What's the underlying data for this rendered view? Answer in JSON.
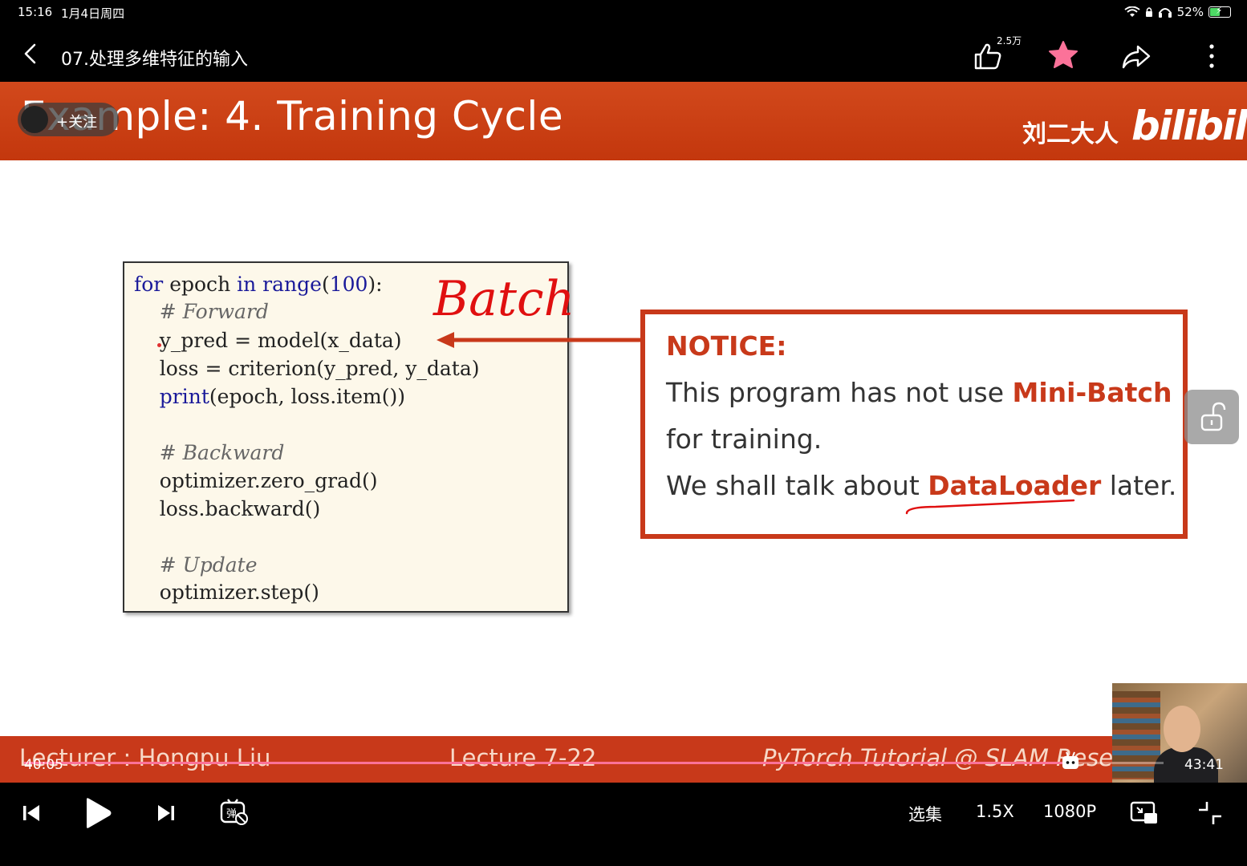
{
  "status_bar": {
    "time": "15:16",
    "date": "1月4日周四",
    "battery_percent": "52%",
    "battery_level": 0.52
  },
  "top_bar": {
    "title": "07.处理多维特征的输入",
    "like_count": "2.5万"
  },
  "slide": {
    "title": "Example: 4. Training Cycle",
    "follow_label": "+关注",
    "uploader": "刘二大人",
    "logo_text": "bilibili",
    "code": [
      {
        "parts": [
          {
            "t": "for",
            "c": "kw"
          },
          {
            "t": " epoch ",
            "c": ""
          },
          {
            "t": "in",
            "c": "kw"
          },
          {
            "t": " range",
            "c": "kw"
          },
          {
            "t": "(",
            "c": ""
          },
          {
            "t": "100",
            "c": "num"
          },
          {
            "t": "):",
            "c": ""
          }
        ]
      },
      {
        "parts": [
          {
            "t": "    # Forward",
            "c": "cmt"
          }
        ]
      },
      {
        "parts": [
          {
            "t": "    y_pred = model(x_data)",
            "c": ""
          }
        ]
      },
      {
        "parts": [
          {
            "t": "    loss = criterion(y_pred, y_data)",
            "c": ""
          }
        ]
      },
      {
        "parts": [
          {
            "t": "    ",
            "c": ""
          },
          {
            "t": "print",
            "c": "kw"
          },
          {
            "t": "(epoch, loss.item())",
            "c": ""
          }
        ]
      },
      {
        "parts": [
          {
            "t": "",
            "c": ""
          }
        ]
      },
      {
        "parts": [
          {
            "t": "    # Backward",
            "c": "cmt"
          }
        ]
      },
      {
        "parts": [
          {
            "t": "    optimizer.zero_grad()",
            "c": ""
          }
        ]
      },
      {
        "parts": [
          {
            "t": "    loss.backward()",
            "c": ""
          }
        ]
      },
      {
        "parts": [
          {
            "t": "",
            "c": ""
          }
        ]
      },
      {
        "parts": [
          {
            "t": "    # Update",
            "c": "cmt"
          }
        ]
      },
      {
        "parts": [
          {
            "t": "    optimizer.step()",
            "c": ""
          }
        ]
      }
    ],
    "handwritten_note": "Batch",
    "notice": {
      "heading": "NOTICE:",
      "line1_pre": "This program has not use ",
      "line1_hl": "Mini-Batch",
      "line2": "for training.",
      "line3_pre": "We shall talk about ",
      "line3_hl": "DataLoader",
      "line3_post": " later."
    },
    "footer": {
      "lecturer": "Lecturer : Hongpu Liu",
      "lecture_number": "Lecture 7-22",
      "course": "PyTorch Tutorial @ SLAM Resea"
    }
  },
  "player": {
    "current_time": "40:05",
    "total_time": "43:41",
    "progress": 0.918,
    "episodes_label": "选集",
    "speed_label": "1.5X",
    "quality_label": "1080P"
  },
  "colors": {
    "slide_accent": "#c8391a",
    "progress": "#fb7299",
    "favorite": "#fb7299"
  }
}
